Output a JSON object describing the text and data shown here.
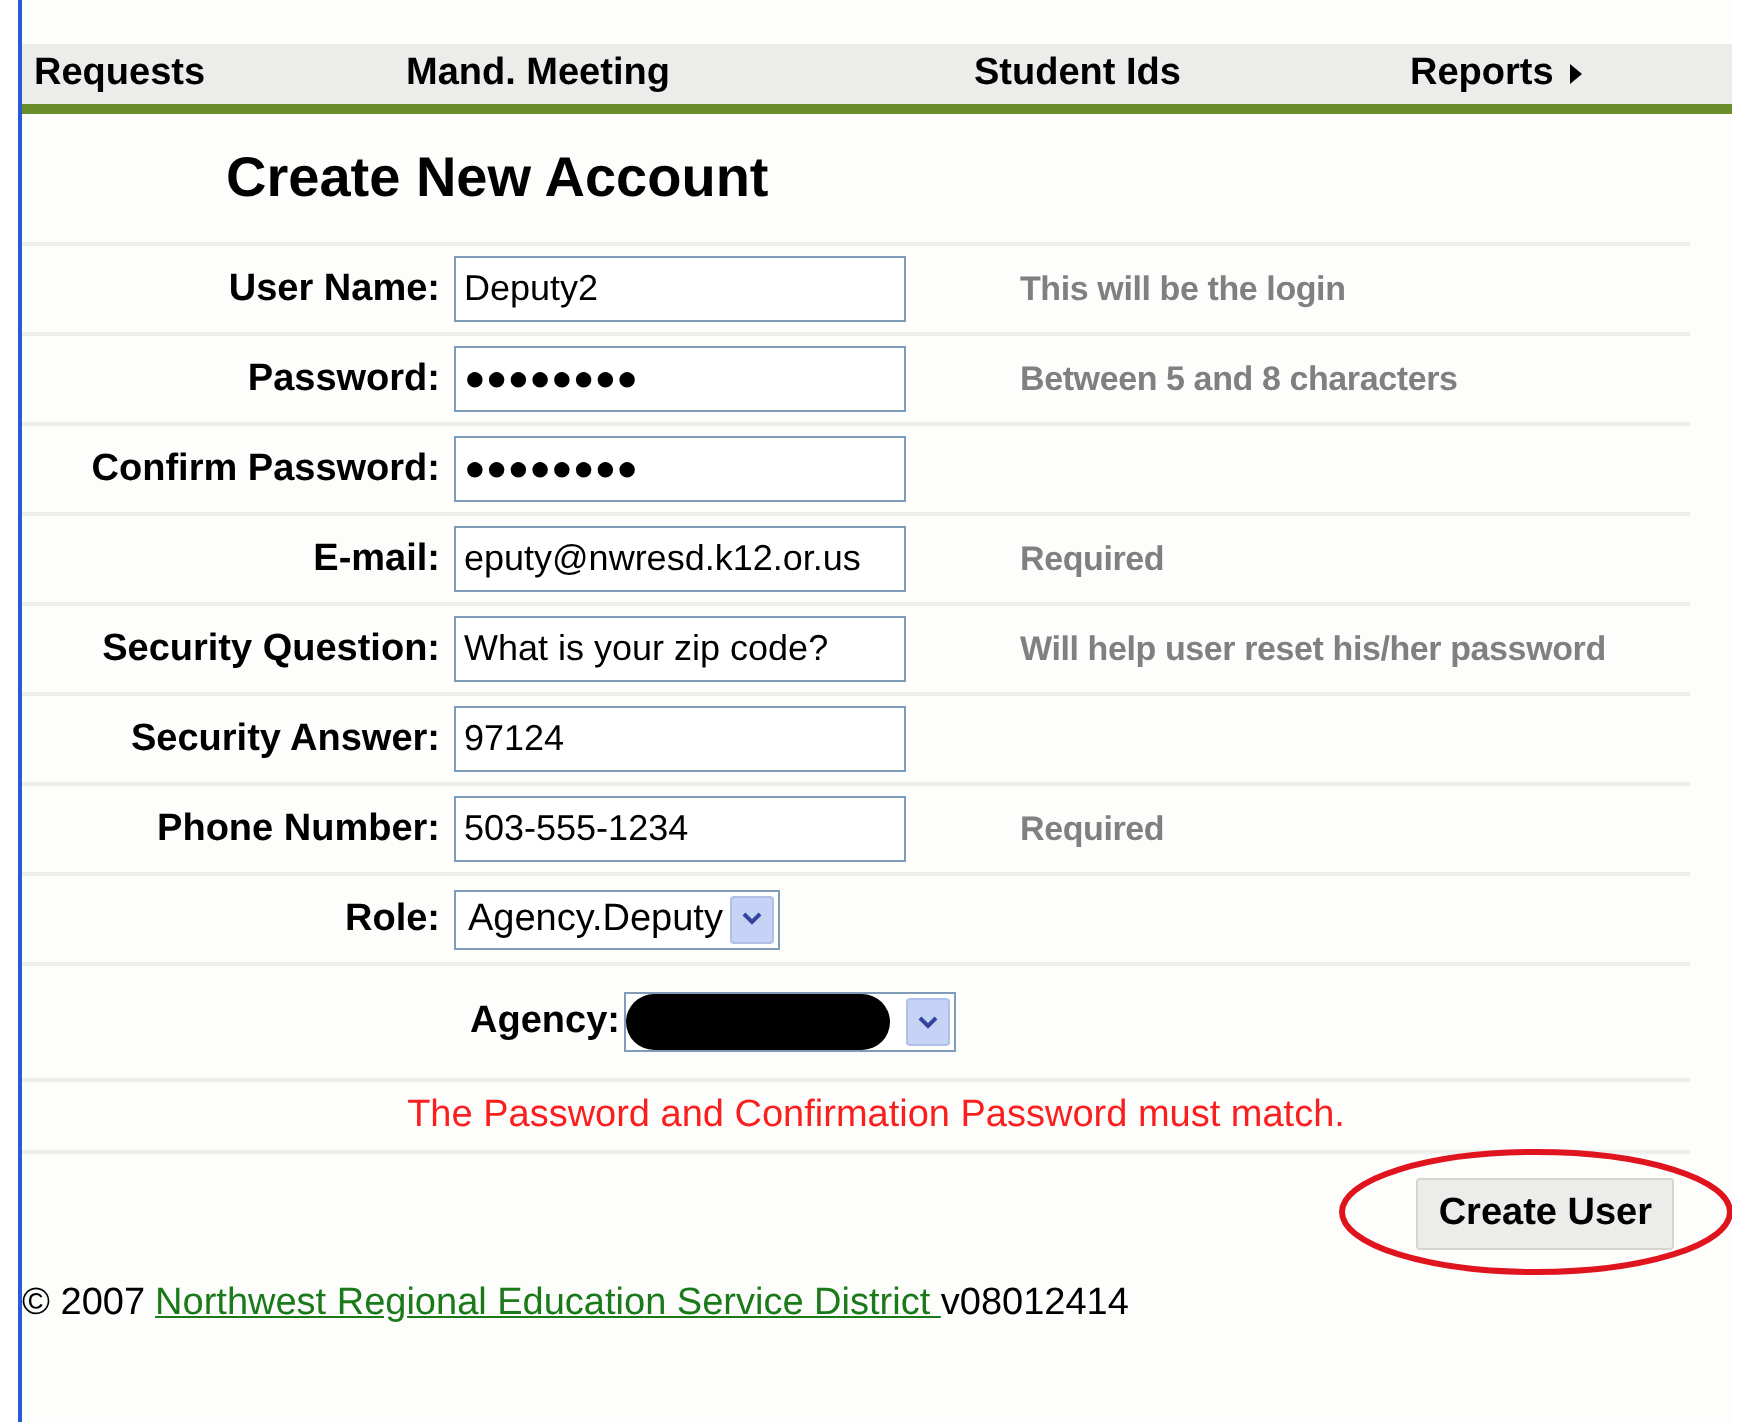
{
  "nav": [
    {
      "label": "Requests",
      "submenu": false
    },
    {
      "label": "Mand. Meeting",
      "submenu": false
    },
    {
      "label": "Student Ids",
      "submenu": false
    },
    {
      "label": "Reports",
      "submenu": true
    }
  ],
  "title": "Create New Account",
  "fields": [
    {
      "kind": "text",
      "label": "User Name:",
      "value": "Deputy2",
      "hint": "This will be the login"
    },
    {
      "kind": "text",
      "label": "Password:",
      "value": "●●●●●●●●",
      "hint": "Between 5 and 8 characters"
    },
    {
      "kind": "text",
      "label": "Confirm Password:",
      "value": "●●●●●●●●"
    },
    {
      "kind": "text",
      "label": "E-mail:",
      "value": "eputy@nwresd.k12.or.us",
      "hint": "Required"
    },
    {
      "kind": "text",
      "label": "Security Question:",
      "value": "What is your zip code?",
      "hint": "Will help user reset his/her password"
    },
    {
      "kind": "text",
      "label": "Security Answer:",
      "value": "97124"
    },
    {
      "kind": "text",
      "label": "Phone Number:",
      "value": "503-555-1234",
      "hint": "Required"
    },
    {
      "kind": "select",
      "label": "Role:",
      "value": "Agency.Deputy"
    },
    {
      "kind": "redacted",
      "label": "Agency:"
    }
  ],
  "error": "The Password and Confirmation Password must match.",
  "submit": {
    "label": "Create User",
    "circled": true
  },
  "footer": {
    "copyright": "© 2007",
    "link": "Northwest Regional Education Service District ",
    "version": "v08012414"
  }
}
